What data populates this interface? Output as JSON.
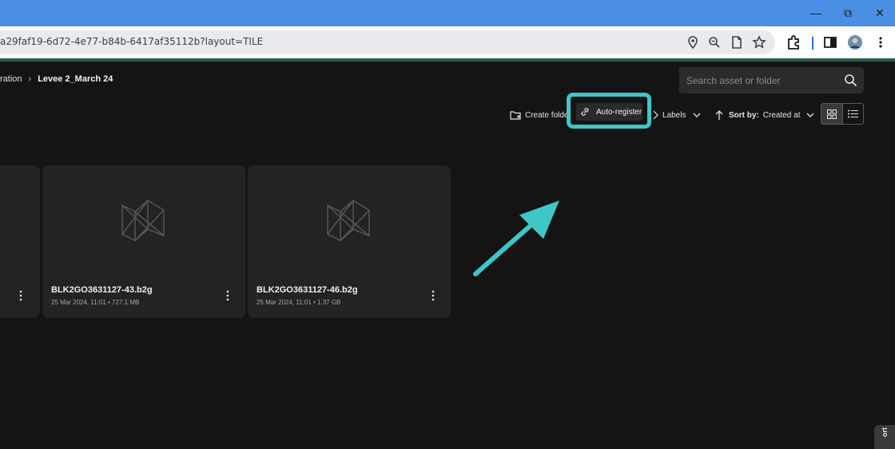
{
  "browser": {
    "url": "a29faf19-6d72-4e77-b84b-6417af35112b?layout=TILE",
    "window_controls": [
      "minimize",
      "restore",
      "close"
    ]
  },
  "breadcrumb": {
    "parent": "ration",
    "current": "Levee 2_March 24"
  },
  "search": {
    "placeholder": "Search asset or folder"
  },
  "actions": {
    "create_folder": "Create folde",
    "auto_register": "Auto-register",
    "labels": "Labels",
    "sort_by_label": "Sort by:",
    "sort_by_value": "Created at"
  },
  "tiles": [
    {
      "name": "",
      "meta": ""
    },
    {
      "name": "BLK2GO3631127-43.b2g",
      "meta": "25 Mar 2024, 11:01 • 727.1 MB"
    },
    {
      "name": "BLK2GO3631127-46.b2g",
      "meta": "25 Mar 2024, 11:01 • 1.37 GB"
    }
  ],
  "side_tab": "ort",
  "colors": {
    "highlight": "#3ec7c7",
    "browser_titlebar": "#4a8fe3",
    "background": "#141414",
    "tile": "#232323"
  },
  "icons": [
    "location-icon",
    "zoom-icon",
    "page-icon",
    "star-icon",
    "extensions-icon",
    "sidepanel-icon",
    "avatar",
    "more-vert-icon",
    "search-icon",
    "folder-add-icon",
    "link-icon",
    "label-icon",
    "chevron-down-icon",
    "arrow-up-icon",
    "grid-view-icon",
    "list-view-icon",
    "model-placeholder-icon",
    "kebab-icon"
  ]
}
